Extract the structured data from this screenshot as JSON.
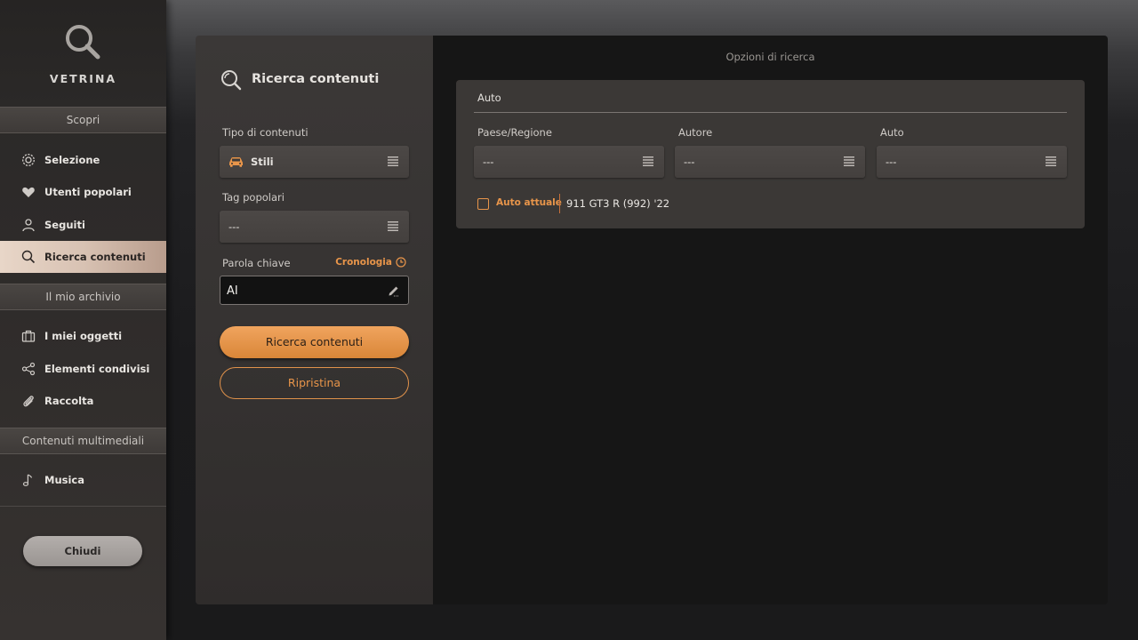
{
  "sidebar": {
    "brand": "VETRINA",
    "sections": {
      "discover": "Scopri",
      "archive": "Il mio archivio",
      "media": "Contenuti multimediali"
    },
    "items": [
      {
        "label": "Selezione",
        "icon": "gear-icon"
      },
      {
        "label": "Utenti popolari",
        "icon": "heart-icon"
      },
      {
        "label": "Seguiti",
        "icon": "user-icon"
      },
      {
        "label": "Ricerca contenuti",
        "icon": "search-icon",
        "active": true
      },
      {
        "label": "I miei oggetti",
        "icon": "briefcase-icon"
      },
      {
        "label": "Elementi condivisi",
        "icon": "share-icon"
      },
      {
        "label": "Raccolta",
        "icon": "paperclip-icon"
      },
      {
        "label": "Musica",
        "icon": "music-note-icon"
      }
    ],
    "close_label": "Chiudi"
  },
  "search_panel": {
    "title": "Ricerca contenuti",
    "content_type_label": "Tipo di contenuti",
    "content_type_value": "Stili",
    "tags_label": "Tag popolari",
    "tags_value": "---",
    "keyword_label": "Parola chiave",
    "history_label": "Cronologia",
    "keyword_value": "AI",
    "search_button": "Ricerca contenuti",
    "reset_button": "Ripristina"
  },
  "options_panel": {
    "title": "Opzioni di ricerca",
    "card_title": "Auto",
    "filters": [
      {
        "label": "Paese/Regione",
        "value": "---"
      },
      {
        "label": "Autore",
        "value": "---"
      },
      {
        "label": "Auto",
        "value": "---"
      }
    ],
    "current_car_label": "Auto attuale",
    "current_car_name": "911 GT3 R (992) '22"
  },
  "colors": {
    "accent": "#e8954a",
    "active_nav": "#e2cfc1"
  }
}
